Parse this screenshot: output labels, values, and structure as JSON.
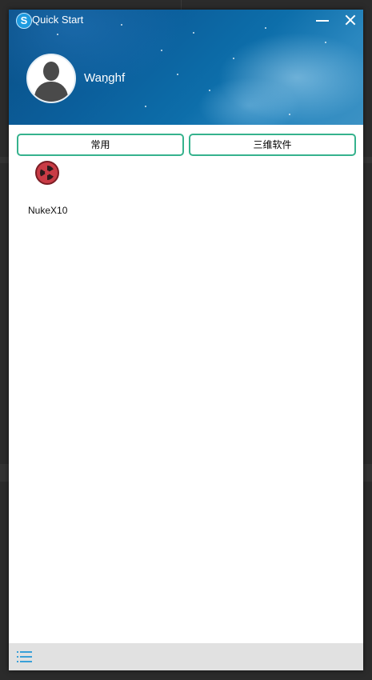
{
  "window": {
    "title": "Quick Start",
    "app_icon_letter": "S",
    "minimize_icon": "minimize-icon",
    "close_icon": "close-icon"
  },
  "user": {
    "name": "Wanghf",
    "avatar_icon": "default-user-avatar-icon"
  },
  "tabs": [
    {
      "label": "常用"
    },
    {
      "label": "三维软件"
    }
  ],
  "apps": [
    {
      "label": "NukeX10",
      "icon": "nuke-icon"
    }
  ],
  "footer": {
    "menu_icon": "list-menu-icon"
  },
  "colors": {
    "accent": "#35b28d",
    "banner": "#0b5f9c",
    "footer": "#e1e1e1",
    "menu_icon": "#3aa0d8"
  }
}
